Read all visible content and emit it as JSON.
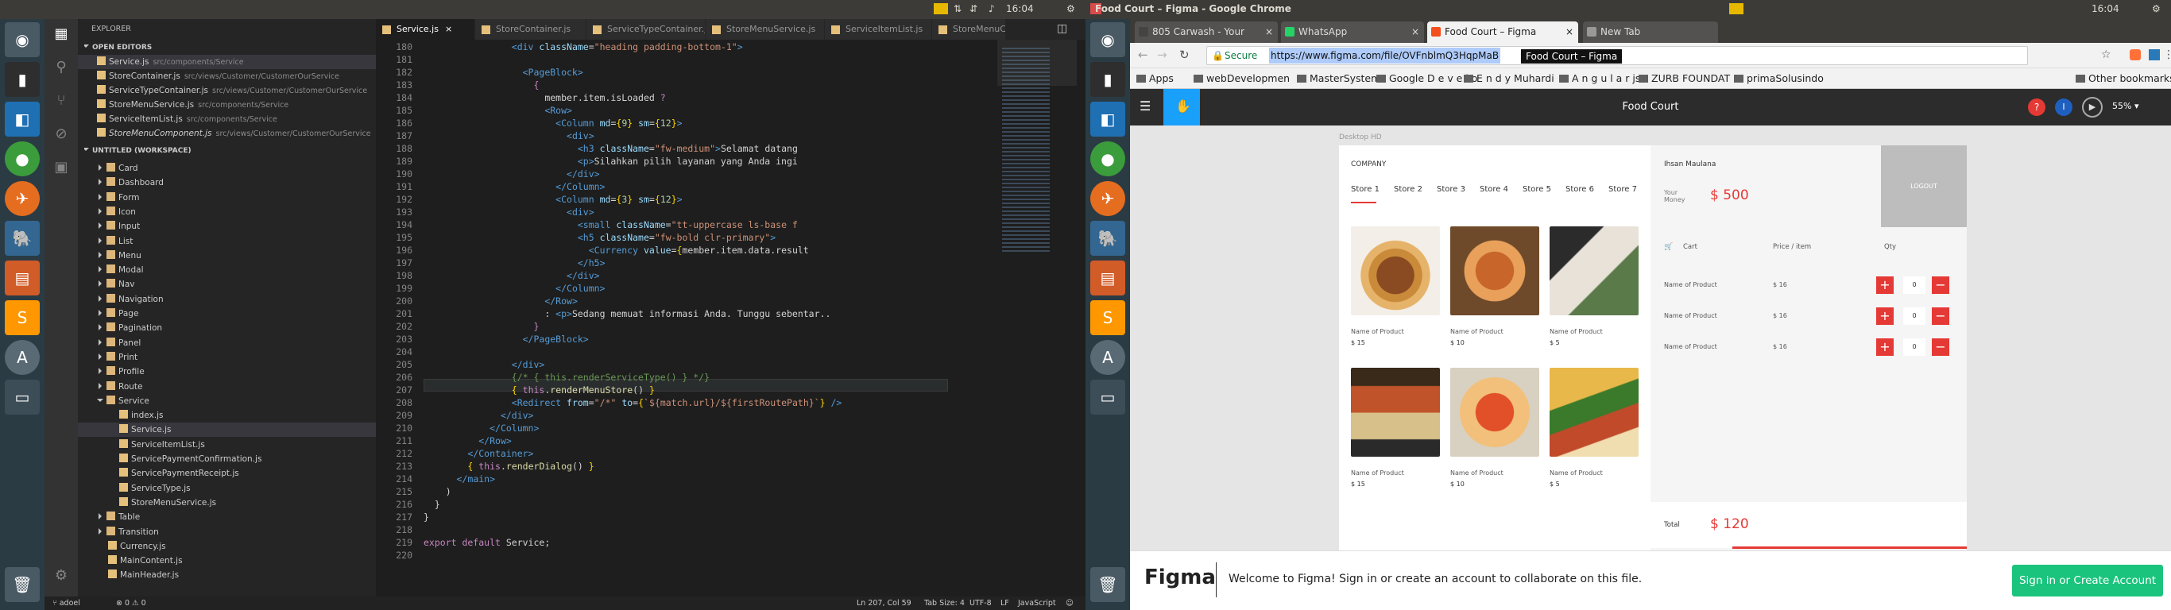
{
  "top_left": {
    "time": "16:04"
  },
  "top_right": {
    "window_title": "Food Court – Figma - Google Chrome",
    "time": "16:04"
  },
  "vscode": {
    "explorer_title": "EXPLORER",
    "open_editors_label": "OPEN EDITORS",
    "open_editors": [
      {
        "name": "Service.js",
        "path": "src/components/Service"
      },
      {
        "name": "StoreContainer.js",
        "path": "src/views/Customer/CustomerOurService"
      },
      {
        "name": "ServiceTypeContainer.js",
        "path": "src/views/Customer/CustomerOurService"
      },
      {
        "name": "StoreMenuService.js",
        "path": "src/components/Service"
      },
      {
        "name": "ServiceItemList.js",
        "path": "src/components/Service"
      },
      {
        "name": "StoreMenuComponent.js",
        "path": "src/views/Customer/CustomerOurService"
      }
    ],
    "workspace_label": "UNTITLED (WORKSPACE)",
    "tree": [
      {
        "name": "Card",
        "type": "dir"
      },
      {
        "name": "Dashboard",
        "type": "dir"
      },
      {
        "name": "Form",
        "type": "dir"
      },
      {
        "name": "Icon",
        "type": "dir"
      },
      {
        "name": "Input",
        "type": "dir"
      },
      {
        "name": "List",
        "type": "dir"
      },
      {
        "name": "Menu",
        "type": "dir"
      },
      {
        "name": "Modal",
        "type": "dir"
      },
      {
        "name": "Nav",
        "type": "dir"
      },
      {
        "name": "Navigation",
        "type": "dir"
      },
      {
        "name": "Page",
        "type": "dir"
      },
      {
        "name": "Pagination",
        "type": "dir"
      },
      {
        "name": "Panel",
        "type": "dir"
      },
      {
        "name": "Print",
        "type": "dir"
      },
      {
        "name": "Profile",
        "type": "dir"
      },
      {
        "name": "Route",
        "type": "dir"
      },
      {
        "name": "Service",
        "type": "open"
      },
      {
        "name": "index.js",
        "type": "file"
      },
      {
        "name": "Service.js",
        "type": "file"
      },
      {
        "name": "ServiceItemList.js",
        "type": "file"
      },
      {
        "name": "ServicePaymentConfirmation.js",
        "type": "file"
      },
      {
        "name": "ServicePaymentReceipt.js",
        "type": "file"
      },
      {
        "name": "ServiceType.js",
        "type": "file"
      },
      {
        "name": "StoreMenuService.js",
        "type": "file"
      },
      {
        "name": "Table",
        "type": "dir"
      },
      {
        "name": "Transition",
        "type": "dir"
      },
      {
        "name": "Currency.js",
        "type": "file0"
      },
      {
        "name": "MainContent.js",
        "type": "file0"
      },
      {
        "name": "MainHeader.js",
        "type": "file0"
      }
    ],
    "tabs": [
      "Service.js",
      "StoreContainer.js",
      "ServiceTypeContainer.js",
      "StoreMenuService.js",
      "ServiceItemList.js",
      "StoreMenuComp"
    ],
    "line_numbers": [
      "180",
      "181",
      "182",
      "183",
      "184",
      "185",
      "186",
      "187",
      "188",
      "189",
      "190",
      "191",
      "192",
      "193",
      "194",
      "195",
      "196",
      "197",
      "198",
      "199",
      "200",
      "201",
      "202",
      "203",
      "204",
      "205",
      "206",
      "207",
      "208",
      "209",
      "210",
      "211",
      "212",
      "213",
      "214",
      "215",
      "216",
      "217",
      "218",
      "219",
      "220"
    ],
    "status": {
      "user": "adoel",
      "errors": "0",
      "warnings": "0",
      "cursor": "Ln 207, Col 59",
      "tab_size": "Tab Size: 4",
      "encoding": "UTF-8",
      "eol": "LF",
      "language": "JavaScript"
    }
  },
  "chrome": {
    "tabs": [
      "805 Carwash - Your",
      "WhatsApp",
      "Food Court – Figma",
      "New Tab"
    ],
    "secure_label": "Secure",
    "url": "https://www.figma.com/file/OVFnblmQ3HqpMaB",
    "tooltip": "Food Court – Figma",
    "bookmarks": [
      "Apps",
      "webDevelopmen",
      "MasterSystem",
      "Google D e v e l o",
      "E n d y  Muhardi",
      "A n g u l a r  js",
      "ZURB FOUNDAT",
      "primaSolusindo"
    ],
    "other_bookmarks": "Other bookmarks"
  },
  "figma": {
    "file_title": "Food Court",
    "zoom": "55%",
    "avatar_letter": "I",
    "frame_label": "Desktop HD",
    "company": "COMPANY",
    "stores": [
      "Store 1",
      "Store 2",
      "Store 3",
      "Store 4",
      "Store 5",
      "Store 6",
      "Store 7"
    ],
    "products": [
      {
        "name": "Name of Product",
        "price": "$ 15"
      },
      {
        "name": "Name of Product",
        "price": "$ 10"
      },
      {
        "name": "Name of Product",
        "price": "$ 5"
      },
      {
        "name": "Name of Product",
        "price": "$ 15"
      },
      {
        "name": "Name of Product",
        "price": "$ 10"
      },
      {
        "name": "Name of Product",
        "price": "$ 5"
      }
    ],
    "user_name": "Ihsan Maulana",
    "money_label": "Your Money",
    "money_value": "$ 500",
    "logout": "LOGOUT",
    "cart_headers": [
      "Cart",
      "Price / item",
      "Qty"
    ],
    "cart_rows": [
      {
        "name": "Name of Product",
        "price": "$ 16",
        "qty": "0"
      },
      {
        "name": "Name of Product",
        "price": "$ 16",
        "qty": "0"
      },
      {
        "name": "Name of Product",
        "price": "$ 16",
        "qty": "0"
      }
    ],
    "total_label": "Total",
    "total_value": "$ 120",
    "banner_brand": "Figma",
    "banner_text": "Welcome to Figma! Sign in or create an account to collaborate on this file.",
    "banner_button": "Sign in or Create Account",
    "accent": "#e53935"
  }
}
